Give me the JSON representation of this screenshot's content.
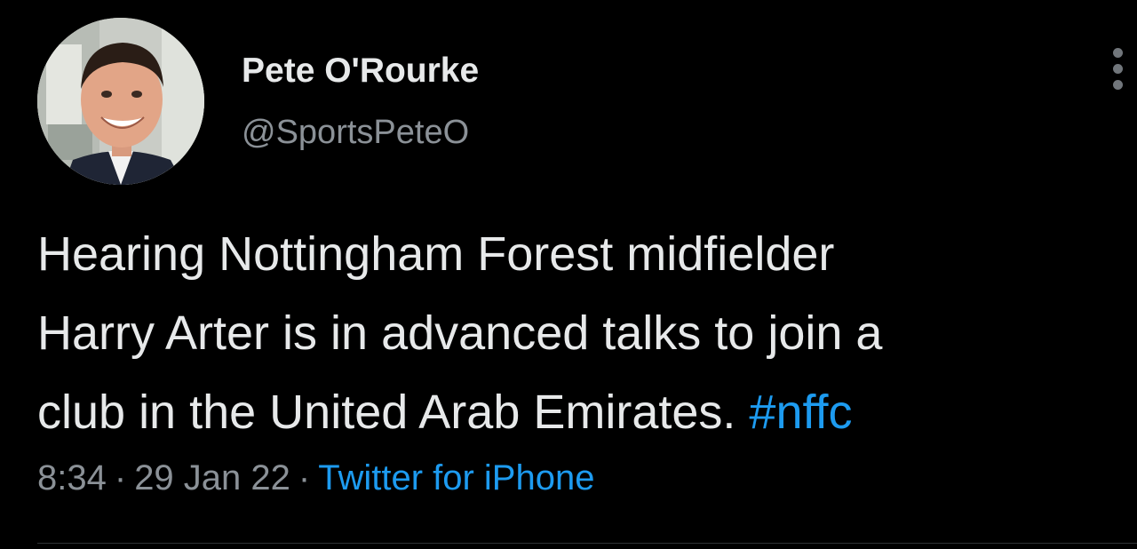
{
  "tweet": {
    "author": {
      "name": "Pete O'Rourke",
      "handle": "@SportsPeteO",
      "avatar_icon": "profile-photo"
    },
    "text_lines": [
      "Hearing Nottingham Forest midfielder",
      "Harry Arter is in advanced talks to join a",
      "club in the United Arab Emirates. "
    ],
    "hashtag": "#nffc",
    "time": "8:34",
    "date": "29 Jan 22",
    "separator": "·",
    "source": "Twitter for iPhone",
    "more_icon": "more-vertical-icon"
  },
  "colors": {
    "background": "#000000",
    "text": "#e7e9ea",
    "secondary": "#8b9197",
    "link": "#1d9bf0"
  }
}
